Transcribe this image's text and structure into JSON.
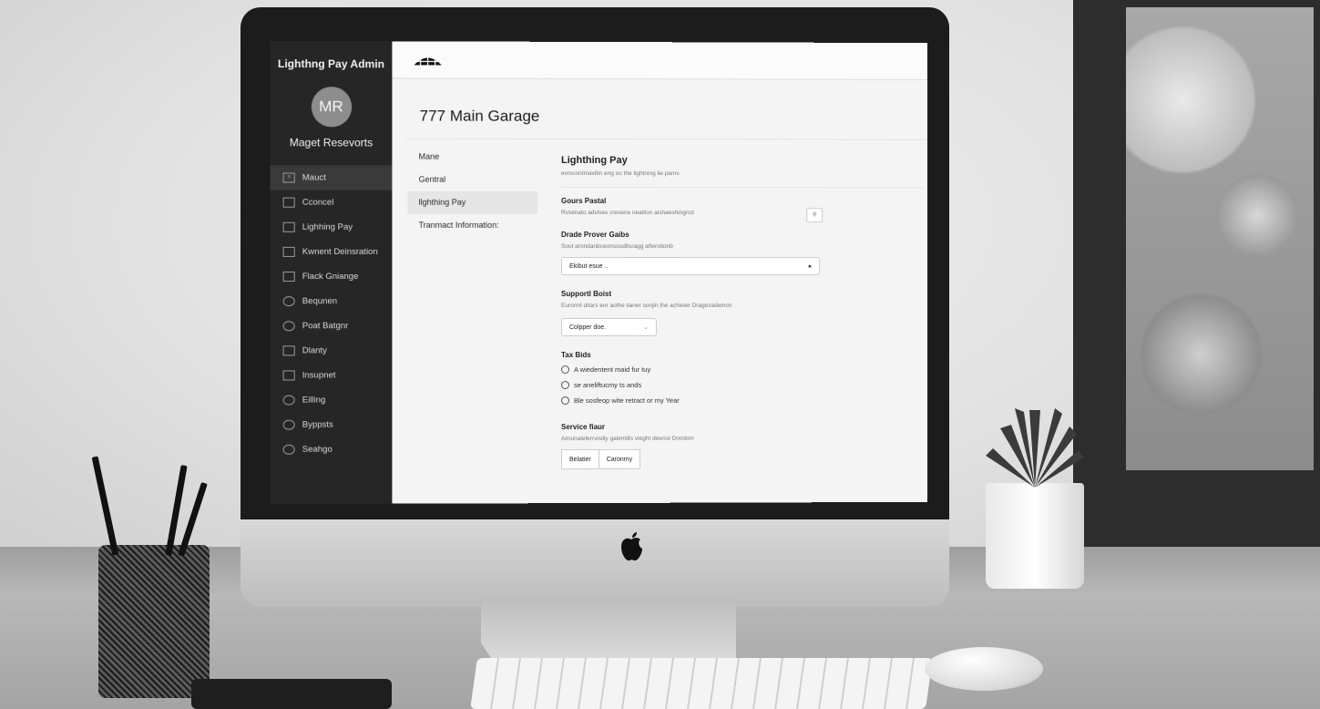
{
  "sidebar": {
    "title": "Lighthng Pay Admin",
    "avatar_initials": "MR",
    "user_name": "Maget Resevorts",
    "items": [
      {
        "label": "Mauct",
        "icon": "list-icon"
      },
      {
        "label": "Cconcel",
        "icon": "doc-icon"
      },
      {
        "label": "Lighhing Pay",
        "icon": "grid-icon"
      },
      {
        "label": "Kwnent Deinsration",
        "icon": "grid-icon"
      },
      {
        "label": "Flack Gniange",
        "icon": "grid-icon"
      },
      {
        "label": "Bequnen",
        "icon": "gear-icon"
      },
      {
        "label": "Poat Batgnr",
        "icon": "shield-icon"
      },
      {
        "label": "Dlanty",
        "icon": "grid-icon"
      },
      {
        "label": "Insupnet",
        "icon": "grid-icon"
      },
      {
        "label": "Eilling",
        "icon": "circle-icon"
      },
      {
        "label": "Byppsts",
        "icon": "circle-icon"
      },
      {
        "label": "Seahgo",
        "icon": "gear-icon"
      }
    ]
  },
  "page": {
    "title": "777 Main Garage"
  },
  "subnav": {
    "items": [
      {
        "label": "Mane"
      },
      {
        "label": "Gentral"
      },
      {
        "label": "llghthing Pay"
      },
      {
        "label": "Tranmact Information:"
      }
    ]
  },
  "content": {
    "heading": "Lighthing Pay",
    "description": "evmcontmavitin eng oo the lightning lie pams",
    "gours_portal": {
      "label": "Gours Pastal",
      "description": "Rvsenato advises cresene neallion aishaeshingrcd"
    },
    "provider": {
      "label": "Drade Prover Gaibs",
      "description": "Sout arondanbceonsouditsragg afterotionb",
      "select_value": "Ekibut esue .."
    },
    "support": {
      "label": "Supportl Boist",
      "description": "Eurorml ditars eor aothe tianer sonjin the achieier Dragezadeinon",
      "select_value": "Colpper doe."
    },
    "tax": {
      "label": "Tax Bids",
      "options": [
        "A wiedentent maid fur tuy",
        "se aneliftucmy ts ands",
        "Ble sosfeop wite retract or my Year"
      ]
    },
    "service": {
      "label": "Service fiaur",
      "description": "Ainsinaleferrvisilly galemilts vieght deerce Drestion",
      "buttons": [
        "Belatier",
        "Caronmy"
      ]
    }
  }
}
